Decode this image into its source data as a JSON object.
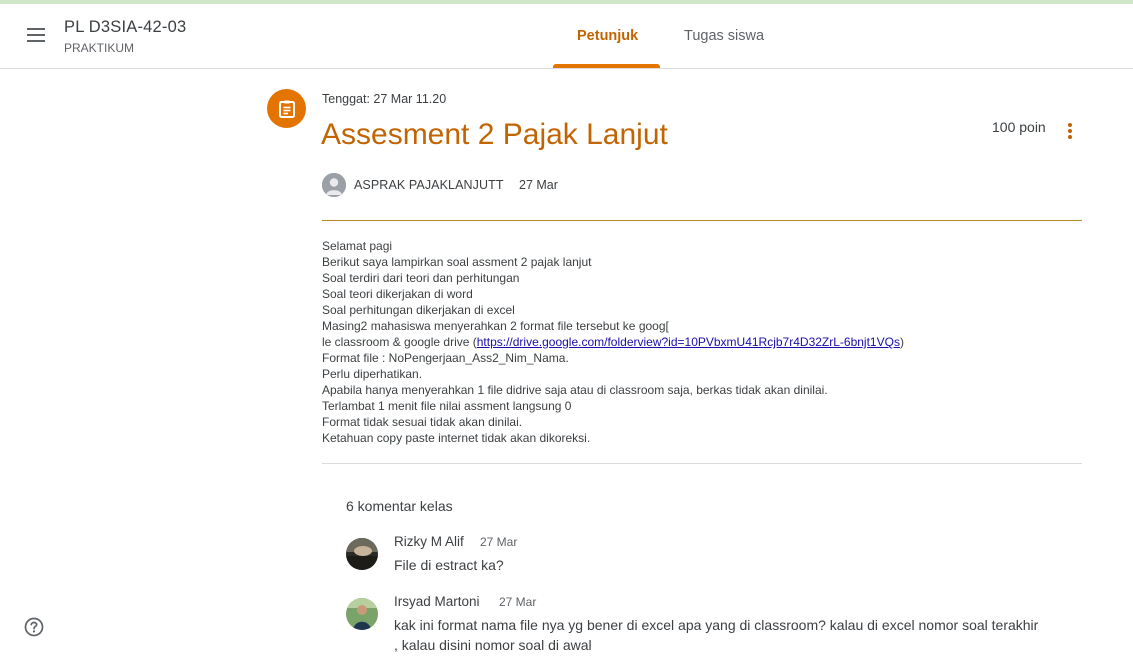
{
  "header": {
    "class_title": "PL D3SIA-42-03",
    "class_subtitle": "PRAKTIKUM",
    "tabs": [
      {
        "label": "Petunjuk",
        "active": true
      },
      {
        "label": "Tugas siswa",
        "active": false
      }
    ]
  },
  "assignment": {
    "due": "Tenggat: 27 Mar 11.20",
    "title": "Assesment 2 Pajak Lanjut",
    "points": "100 poin",
    "author": "ASPRAK PAJAKLANJUTT",
    "date": "27 Mar",
    "body_lines": [
      "Selamat pagi",
      "Berikut saya lampirkan soal assment 2 pajak lanjut",
      "Soal terdiri dari teori dan perhitungan",
      "Soal teori dikerjakan di word",
      "Soal perhitungan dikerjakan di excel",
      "Masing2 mahasiswa menyerahkan 2 format file tersebut ke goog[",
      "le classroom & google drive (",
      "Format file : NoPengerjaan_Ass2_Nim_Nama.",
      "Perlu diperhatikan.",
      "Apabila hanya menyerahkan 1 file didrive saja atau di classroom saja, berkas tidak akan dinilai.",
      "Terlambat 1 menit file nilai assment langsung 0",
      "Format tidak sesuai tidak akan dinilai.",
      "Ketahuan copy paste internet tidak akan dikoreksi."
    ],
    "link_text": "https://drive.google.com/folderview?id=10PVbxmU41Rcjb7r4D32ZrL-6bnjt1VQs",
    "link_suffix": ")"
  },
  "comments": {
    "count_label": "6 komentar kelas",
    "items": [
      {
        "name": "Rizky M Alif",
        "date": "27 Mar",
        "text": "File di estract ka?"
      },
      {
        "name": "Irsyad Martoni",
        "date": "27 Mar",
        "text_lines": [
          "kak ini format nama file nya yg bener di excel apa yang di classroom? kalau di excel nomor soal terakhir",
          ", kalau disini nomor soal di awal"
        ]
      }
    ]
  },
  "colors": {
    "accent": "#e37400",
    "accent_text": "#c26401",
    "link": "#1a0dab",
    "divider": "#dadce0"
  },
  "icons": {
    "menu": "hamburger-menu-icon",
    "assignment": "clipboard-icon",
    "more": "more-vert-icon",
    "help": "help-icon"
  }
}
